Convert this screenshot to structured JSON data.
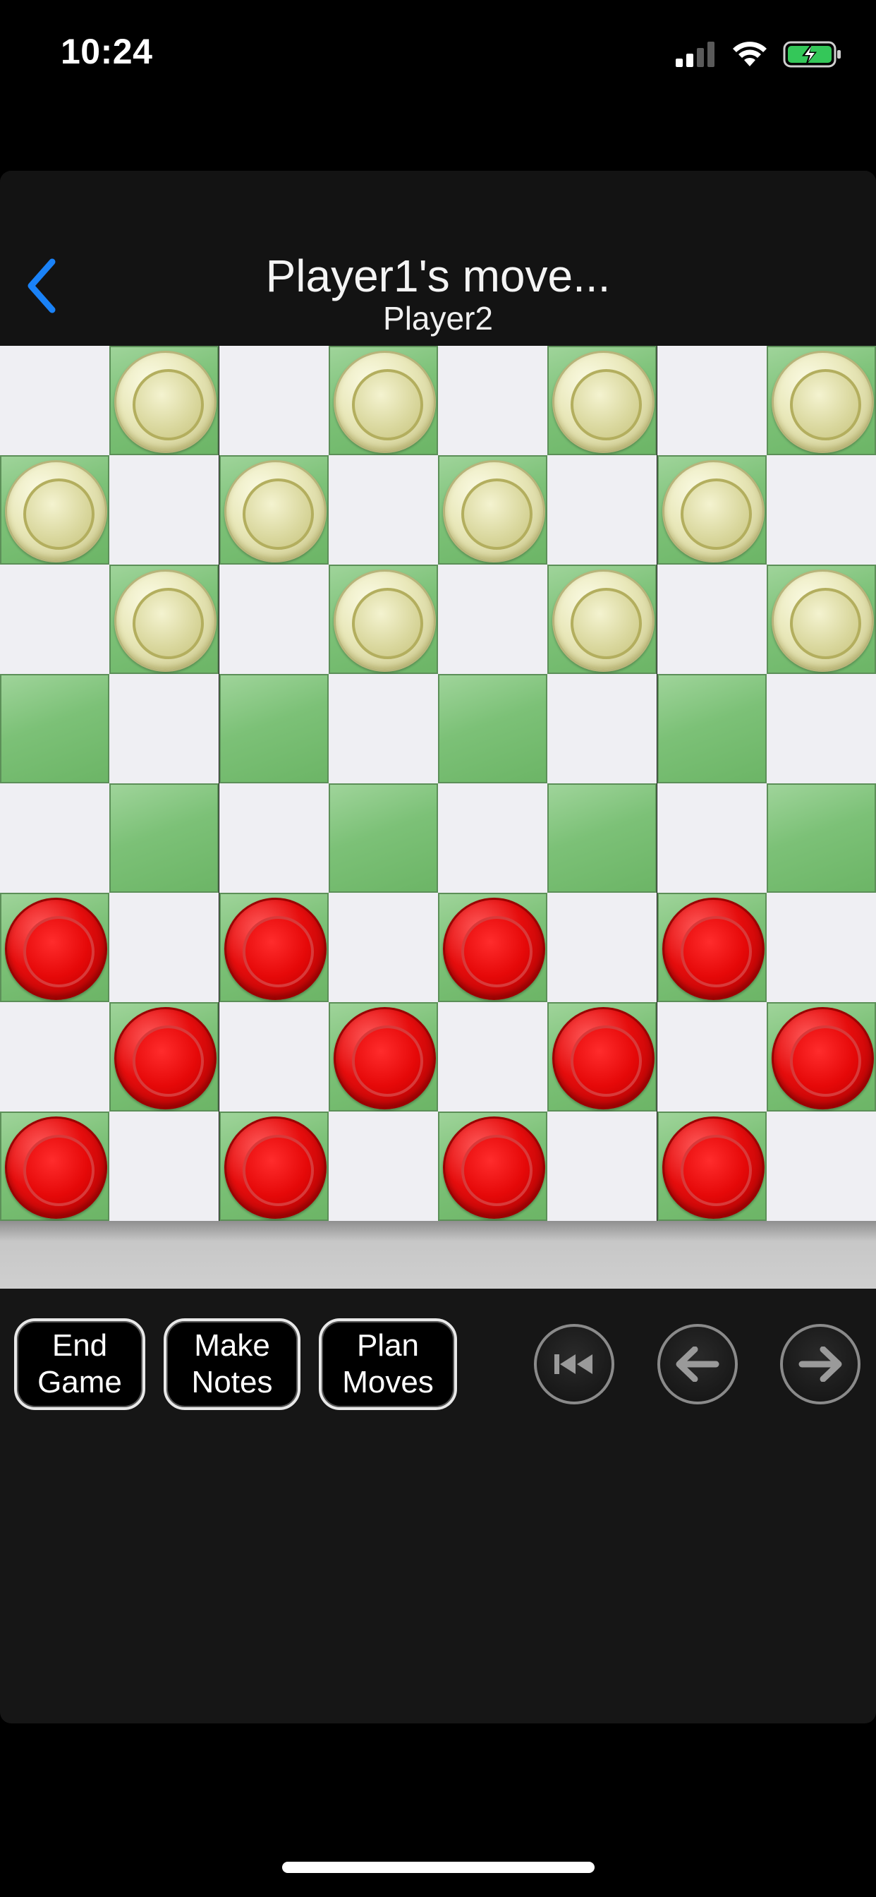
{
  "status_bar": {
    "time": "10:24"
  },
  "nav": {
    "title": "Player1's move...",
    "subtitle": "Player2",
    "back_icon": "chevron-left-icon",
    "accent_color": "#1a82f7"
  },
  "board": {
    "size": 8,
    "rows": [
      ".c.c.c.c",
      "c.c.c.c.",
      ".c.c.c.c",
      "........",
      "........",
      "r.r.r.r.",
      ".r.r.r.r",
      "r.r.r.r."
    ],
    "legend": {
      "c": "cream",
      "r": "red"
    },
    "colors": {
      "light_square": "#efeff3",
      "dark_square": "#7cc177",
      "cream_piece": "#e8e7b8",
      "red_piece": "#e50d0d"
    }
  },
  "controls": {
    "end_game": {
      "line1": "End",
      "line2": "Game"
    },
    "make_notes": {
      "line1": "Make",
      "line2": "Notes"
    },
    "plan_moves": {
      "line1": "Plan",
      "line2": "Moves"
    },
    "first_move_icon": "skip-to-start-icon",
    "previous_move_icon": "arrow-left-icon",
    "next_move_icon": "arrow-right-icon"
  }
}
